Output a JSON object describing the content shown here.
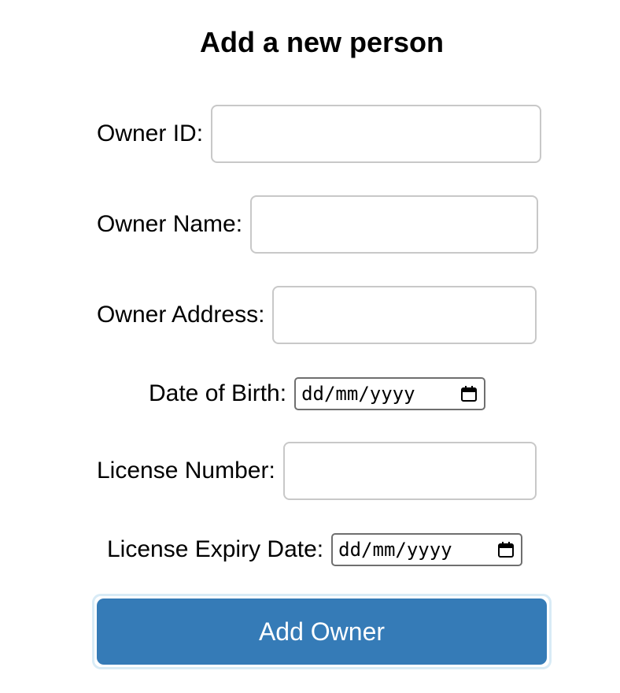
{
  "form": {
    "title": "Add a new person",
    "owner_id": {
      "label": "Owner ID:",
      "value": ""
    },
    "owner_name": {
      "label": "Owner Name:",
      "value": ""
    },
    "owner_address": {
      "label": "Owner Address:",
      "value": ""
    },
    "date_of_birth": {
      "label": "Date of Birth:",
      "placeholder": "dd/mm/yyyy"
    },
    "license_number": {
      "label": "License Number:",
      "value": ""
    },
    "license_expiry": {
      "label": "License Expiry Date:",
      "placeholder": "dd/mm/yyyy"
    },
    "submit_label": "Add Owner"
  },
  "colors": {
    "button": "#357bb7",
    "button_text": "#ffffff",
    "input_border": "#c8c8c8"
  },
  "icons": {
    "date_picker": "calendar-icon"
  }
}
